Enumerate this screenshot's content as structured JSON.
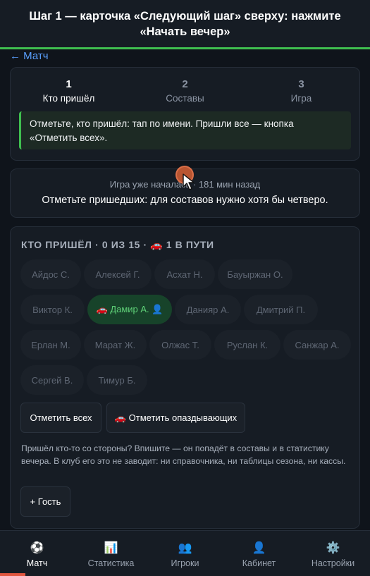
{
  "tutorial": {
    "text": "Шаг 1 — карточка «Следующий шаг» сверху: нажмите «Начать вечер»",
    "accent_color": "#3fbf4f"
  },
  "back_link": "← Матч",
  "stepper": {
    "steps": [
      {
        "number": "1",
        "label": "Кто пришёл",
        "active": true
      },
      {
        "number": "2",
        "label": "Составы",
        "active": false
      },
      {
        "number": "3",
        "label": "Игра",
        "active": false
      }
    ],
    "hint": "Отметьте, кто пришёл: тап по имени. Пришли все — кнопка «Отметить всех»."
  },
  "status": {
    "subtitle": "Игра уже началась · 181 мин назад",
    "message": "Отметьте пришедших: для составов нужно хотя бы четверо."
  },
  "attendance": {
    "title": "Кто пришёл · 0 из 15 · 🚗 1 в пути",
    "players": [
      {
        "name": "Айдос С.",
        "state": "absent"
      },
      {
        "name": "Алексей Г.",
        "state": "absent"
      },
      {
        "name": "Асхат Н.",
        "state": "absent"
      },
      {
        "name": "Бауыржан О.",
        "state": "absent"
      },
      {
        "name": "Виктор К.",
        "state": "absent"
      },
      {
        "name": "🚗 Дамир А. 👤",
        "state": "on_the_way"
      },
      {
        "name": "Данияр А.",
        "state": "absent"
      },
      {
        "name": "Дмитрий П.",
        "state": "absent"
      },
      {
        "name": "Ерлан М.",
        "state": "absent"
      },
      {
        "name": "Марат Ж.",
        "state": "absent"
      },
      {
        "name": "Олжас Т.",
        "state": "absent"
      },
      {
        "name": "Руслан К.",
        "state": "absent"
      },
      {
        "name": "Санжар А.",
        "state": "absent"
      },
      {
        "name": "Сергей В.",
        "state": "absent"
      },
      {
        "name": "Тимур Б.",
        "state": "absent"
      }
    ],
    "mark_all_label": "Отметить всех",
    "mark_late_label": "🚗 Отметить опаздывающих",
    "guest_note": "Пришёл кто-то со стороны? Впишите — он попадёт в составы и в статистику вечера. В клуб его это не заводит: ни справочника, ни таблицы сезона, ни кассы.",
    "guest_button_label": "+ Гость"
  },
  "bottom_nav": {
    "items": [
      {
        "icon": "⚽",
        "icon_name": "soccer-ball-icon",
        "label": "Матч",
        "active": true
      },
      {
        "icon": "📊",
        "icon_name": "chart-icon",
        "label": "Статистика",
        "active": false
      },
      {
        "icon": "👥",
        "icon_name": "players-icon",
        "label": "Игроки",
        "active": false
      },
      {
        "icon": "👤",
        "icon_name": "profile-icon",
        "label": "Кабинет",
        "active": false
      },
      {
        "icon": "⚙️",
        "icon_name": "gear-icon",
        "label": "Настройки",
        "active": false
      }
    ]
  },
  "colors": {
    "background": "#0f141b",
    "card": "#161c24",
    "accent_green": "#3fbf4f",
    "link_blue": "#5aa0ff",
    "active_nav_indicator": "#e0563f"
  }
}
